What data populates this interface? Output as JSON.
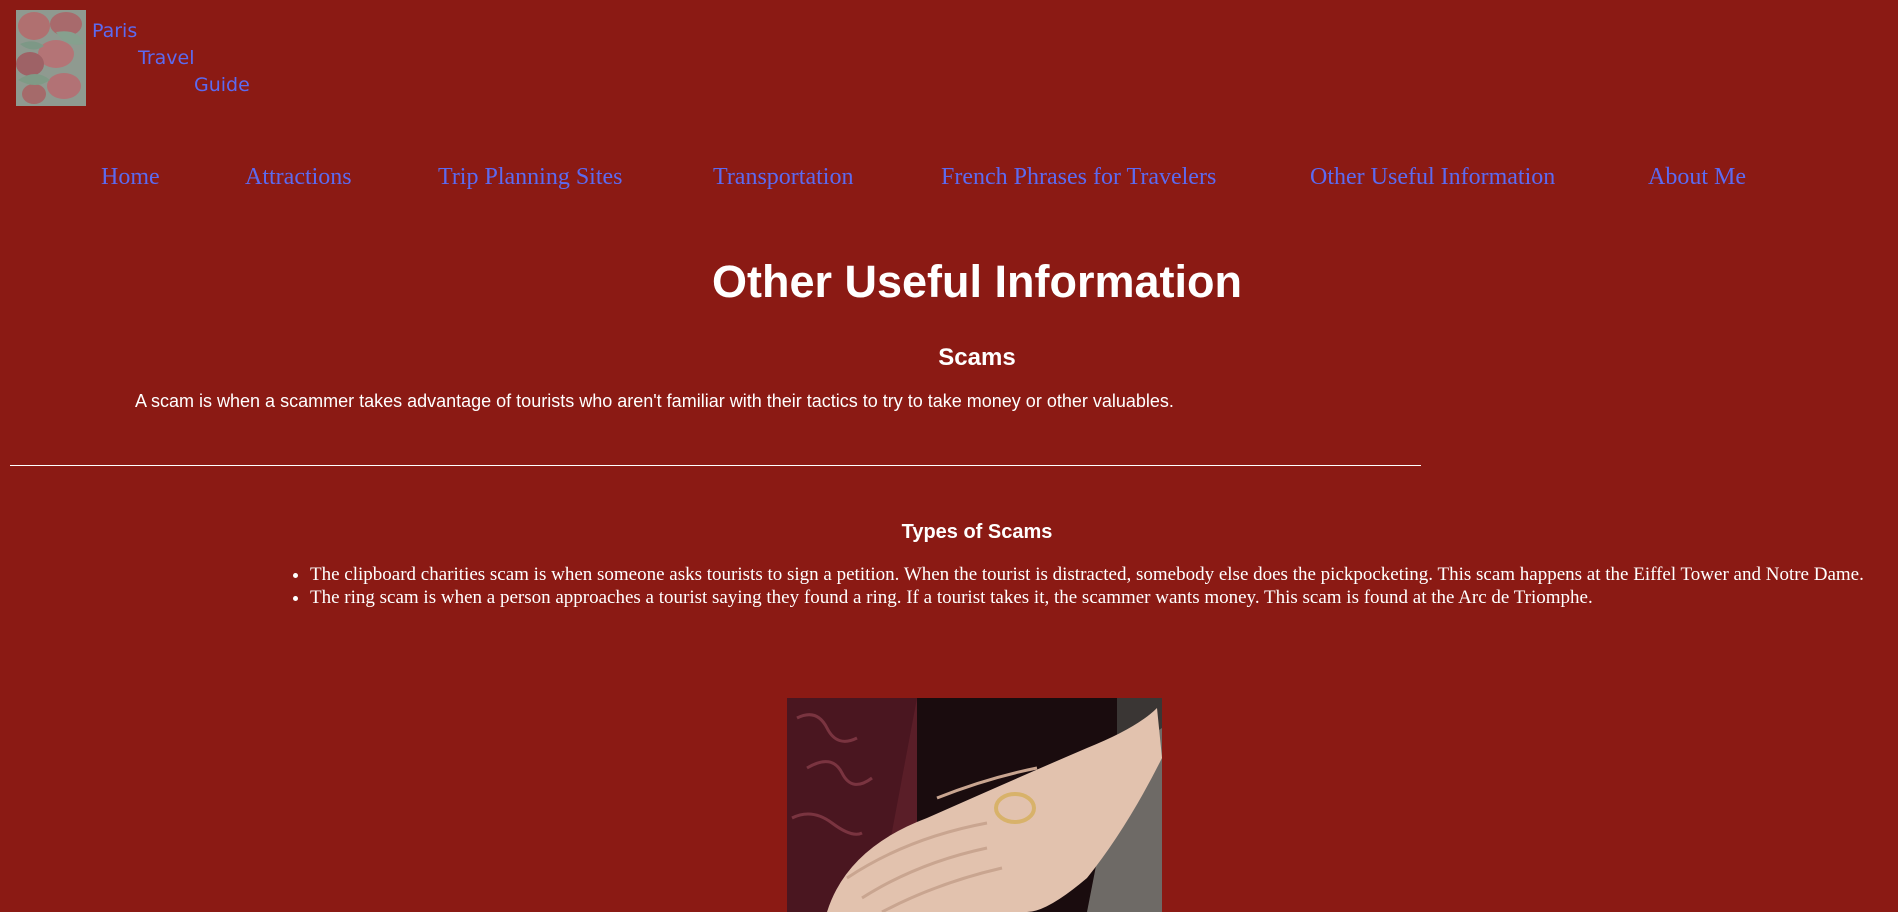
{
  "logo": {
    "line1": "Paris",
    "line2": "Travel",
    "line3": "Guide"
  },
  "nav": {
    "items": [
      "Home",
      "Attractions",
      "Trip Planning Sites",
      "Transportation",
      "French Phrases for Travelers",
      "Other Useful Information",
      "About Me"
    ]
  },
  "page": {
    "title": "Other Useful Information",
    "scams_heading": "Scams",
    "scams_description": "A scam is when a scammer takes advantage of tourists who aren't familiar with their tactics to try to take money or other valuables.",
    "types_heading": "Types of Scams",
    "types": [
      "The clipboard charities scam is when someone asks tourists to sign a petition. When the tourist is distracted, somebody else does the pickpocketing. This scam happens at the Eiffel Tower and Notre Dame.",
      "The ring scam is when a person approaches a tourist saying they found a ring. If a tourist takes it, the scammer wants money. This scam is found at the Arc de Triomphe."
    ]
  },
  "colors": {
    "background": "#8b1a14",
    "link": "#5c6af0",
    "text": "#ffffff"
  }
}
